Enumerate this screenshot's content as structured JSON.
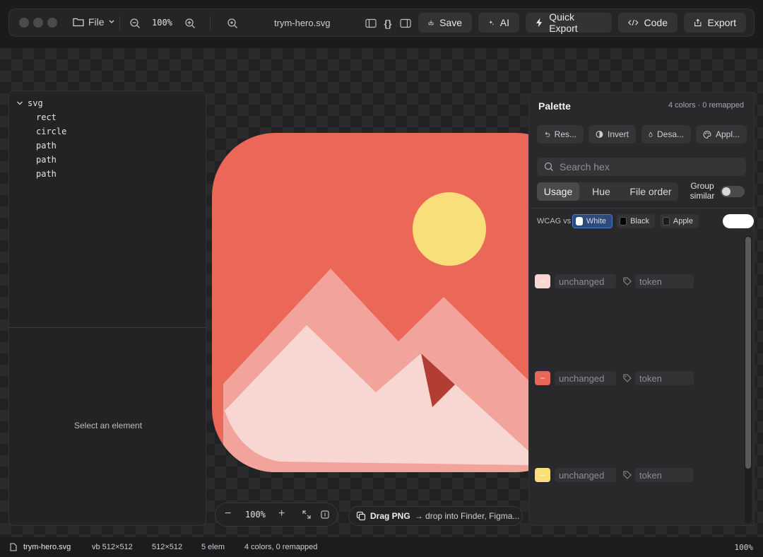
{
  "toolbar": {
    "file_label": "File",
    "zoom": "100%",
    "filename": "trym-hero.svg",
    "save_label": "Save",
    "ai_label": "AI",
    "quick_export_label": "Quick Export",
    "code_label": "Code",
    "export_label": "Export"
  },
  "tree": {
    "root": "svg",
    "children": [
      "rect",
      "circle",
      "path",
      "path",
      "path"
    ]
  },
  "props": {
    "empty_text": "Select an element"
  },
  "canvas": {
    "zoom": "100%",
    "drag_label": "Drag PNG",
    "drag_hint": "→ drop into Finder, Figma..."
  },
  "palette": {
    "title": "Palette",
    "summary": "4 colors · 0 remapped",
    "actions": [
      "Res...",
      "Invert",
      "Desa...",
      "Appl..."
    ],
    "search_placeholder": "Search hex",
    "sort_tabs": [
      "Usage",
      "Hue",
      "File order"
    ],
    "active_sort": "Usage",
    "group_similar_label": "Group similar",
    "wcag_label": "WCAG vs",
    "wcag_options": [
      "White",
      "Black",
      "Apple"
    ],
    "active_wcag": "White",
    "colors": [
      {
        "swatch": "#f8d7d3",
        "status": "unchanged",
        "token": "token"
      },
      {
        "swatch": "#e8675a",
        "status": "unchanged",
        "token": "token"
      },
      {
        "swatch": "#f9df79",
        "status": "unchanged",
        "token": "token"
      }
    ]
  },
  "art_colors": {
    "background": "#eb6858",
    "sun": "#f9df79",
    "mountain_back": "#f2a49c",
    "mountain_front": "#f8d7d3",
    "accent": "#b23d33"
  },
  "statusbar": {
    "filename": "trym-hero.svg",
    "viewbox": "vb 512×512",
    "size": "512×512",
    "elements": "5 elem",
    "colors": "4 colors, 0 remapped",
    "zoom": "100%"
  }
}
